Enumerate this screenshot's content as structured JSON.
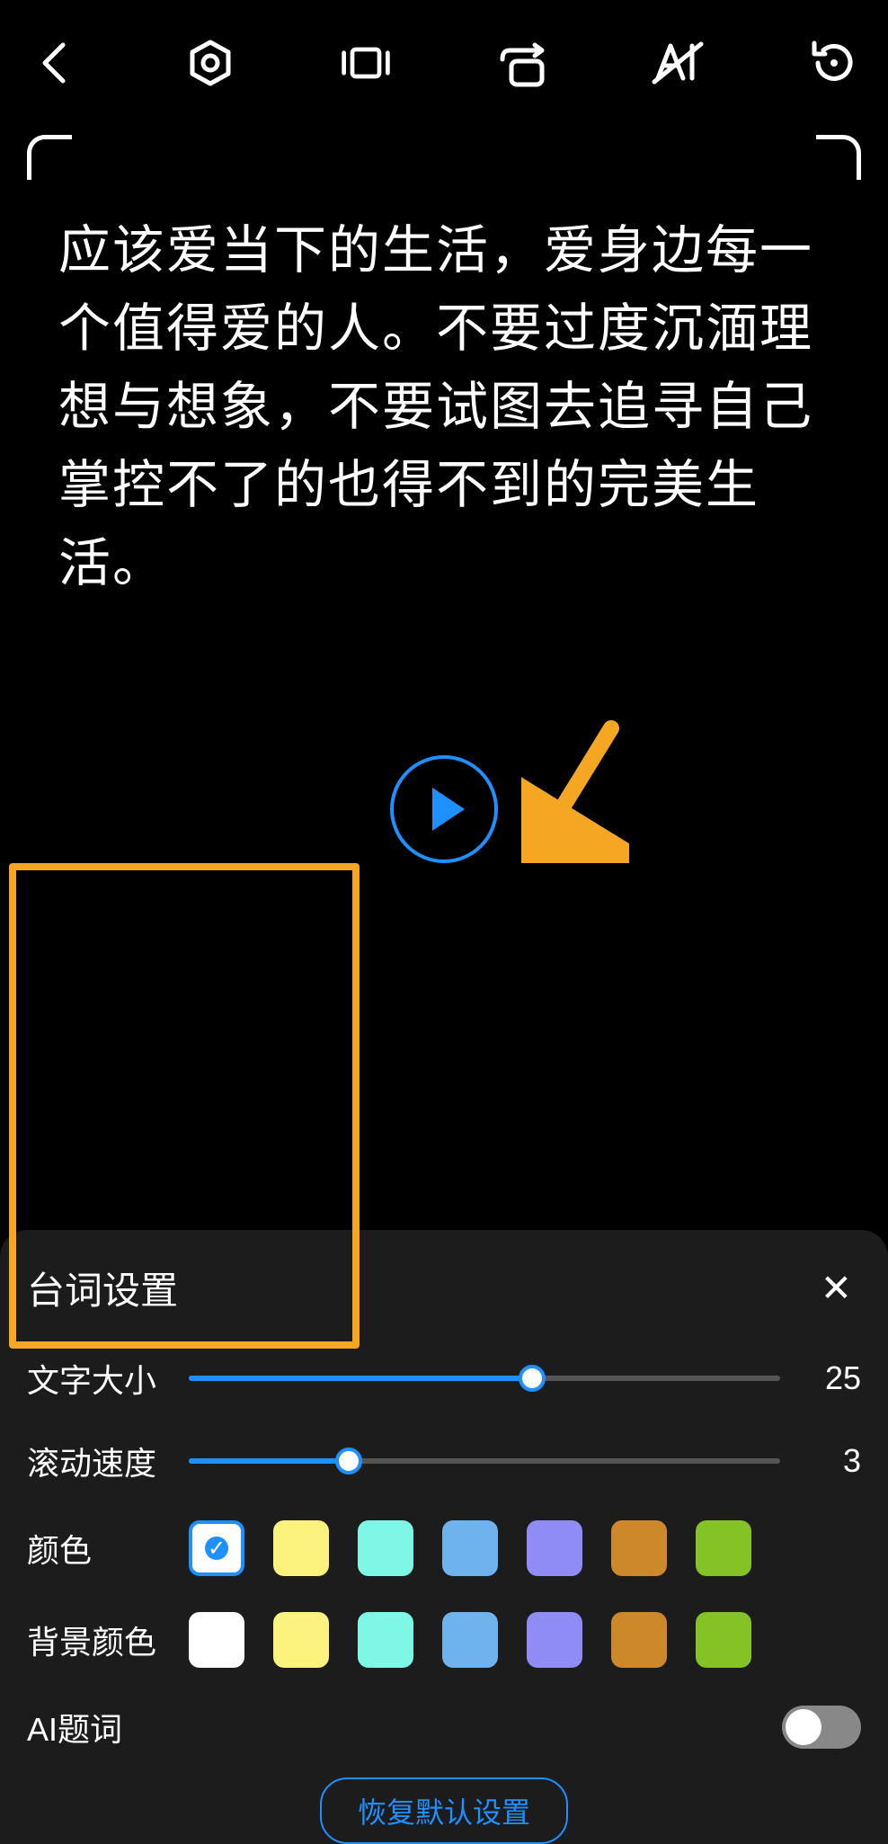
{
  "script_text": "应该爱当下的生活，爱身边每一个值得爱的人。不要过度沉湎理想与想象，不要试图去追寻自己掌控不了的也得不到的完美生活。",
  "panel": {
    "title": "台词设置",
    "font_size": {
      "label": "文字大小",
      "value": "25",
      "percent": 58
    },
    "scroll_speed": {
      "label": "滚动速度",
      "value": "3",
      "percent": 27
    },
    "color": {
      "label": "颜色"
    },
    "bg_color": {
      "label": "背景颜色"
    },
    "ai_prompt": {
      "label": "AI题词"
    },
    "reset": "恢复默认设置"
  },
  "text_colors": [
    "#ffffff",
    "#fcf37e",
    "#7ff7e7",
    "#6eb3ed",
    "#8f8cf5",
    "#cc8829",
    "#85c226"
  ],
  "bg_colors": [
    "#ffffff",
    "#fcf37e",
    "#7ff7e7",
    "#6eb3ed",
    "#8f8cf5",
    "#cc8829",
    "#85c226"
  ],
  "selected_text_color": 0
}
